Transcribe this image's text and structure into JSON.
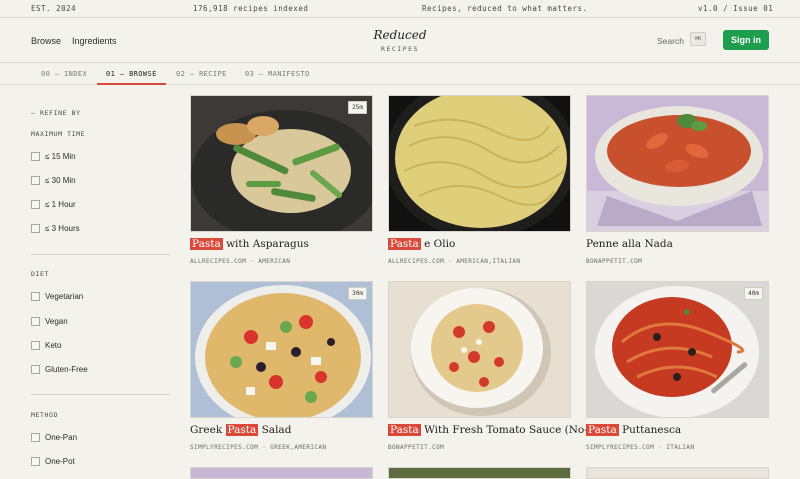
{
  "meta": {
    "est": "EST. 2024",
    "count": "176,918 recipes indexed",
    "tagline": "Recipes, reduced to what matters.",
    "issue": "v1.0 / Issue 01"
  },
  "nav": {
    "browse": "Browse",
    "ingredients": "Ingredients"
  },
  "logo": {
    "title": "Reduced",
    "subtitle": "RECIPES"
  },
  "search": {
    "label": "Search",
    "shortcut": "⌘K"
  },
  "signin": "Sign in",
  "tabs": [
    "00 — INDEX",
    "01 — BROWSE",
    "02 — RECIPE",
    "03 — MANIFESTO"
  ],
  "sidebar": {
    "refine": "— REFINE BY",
    "time_head": "MAXIMUM TIME",
    "time": [
      "≤ 15 Min",
      "≤ 30 Min",
      "≤ 1 Hour",
      "≤ 3 Hours"
    ],
    "diet_head": "DIET",
    "diet": [
      "Vegetarian",
      "Vegan",
      "Keto",
      "Gluten-Free"
    ],
    "method_head": "METHOD",
    "method": [
      "One-Pan",
      "One-Pot"
    ]
  },
  "recipes": [
    {
      "hl": "Pasta",
      "rest": " with Asparagus",
      "pre": "",
      "source": "ALLRECIPES.COM · AMERICAN",
      "time": "25m"
    },
    {
      "hl": "Pasta",
      "rest": " e Olio",
      "pre": "",
      "source": "ALLRECIPES.COM · AMERICAN,ITALIAN",
      "time": ""
    },
    {
      "hl": "",
      "rest": "",
      "pre": "Penne alla Nada",
      "source": "BONAPPETIT.COM",
      "time": ""
    },
    {
      "hl": "Pasta",
      "rest": " Salad",
      "pre": "Greek ",
      "source": "SIMPLYRECIPES.COM · GREEK,AMERICAN",
      "time": "30m"
    },
    {
      "hl": "Pasta",
      "rest": " With Fresh Tomato Sauce (No-Cook)",
      "pre": "",
      "source": "BONAPPETIT.COM",
      "time": ""
    },
    {
      "hl": "Pasta",
      "rest": " Puttanesca",
      "pre": "",
      "source": "SIMPLYRECIPES.COM · ITALIAN",
      "time": "40m"
    }
  ],
  "colors": {
    "accent": "#d94a3a",
    "signin": "#1e9d4e",
    "background": "#f4f2ec"
  }
}
